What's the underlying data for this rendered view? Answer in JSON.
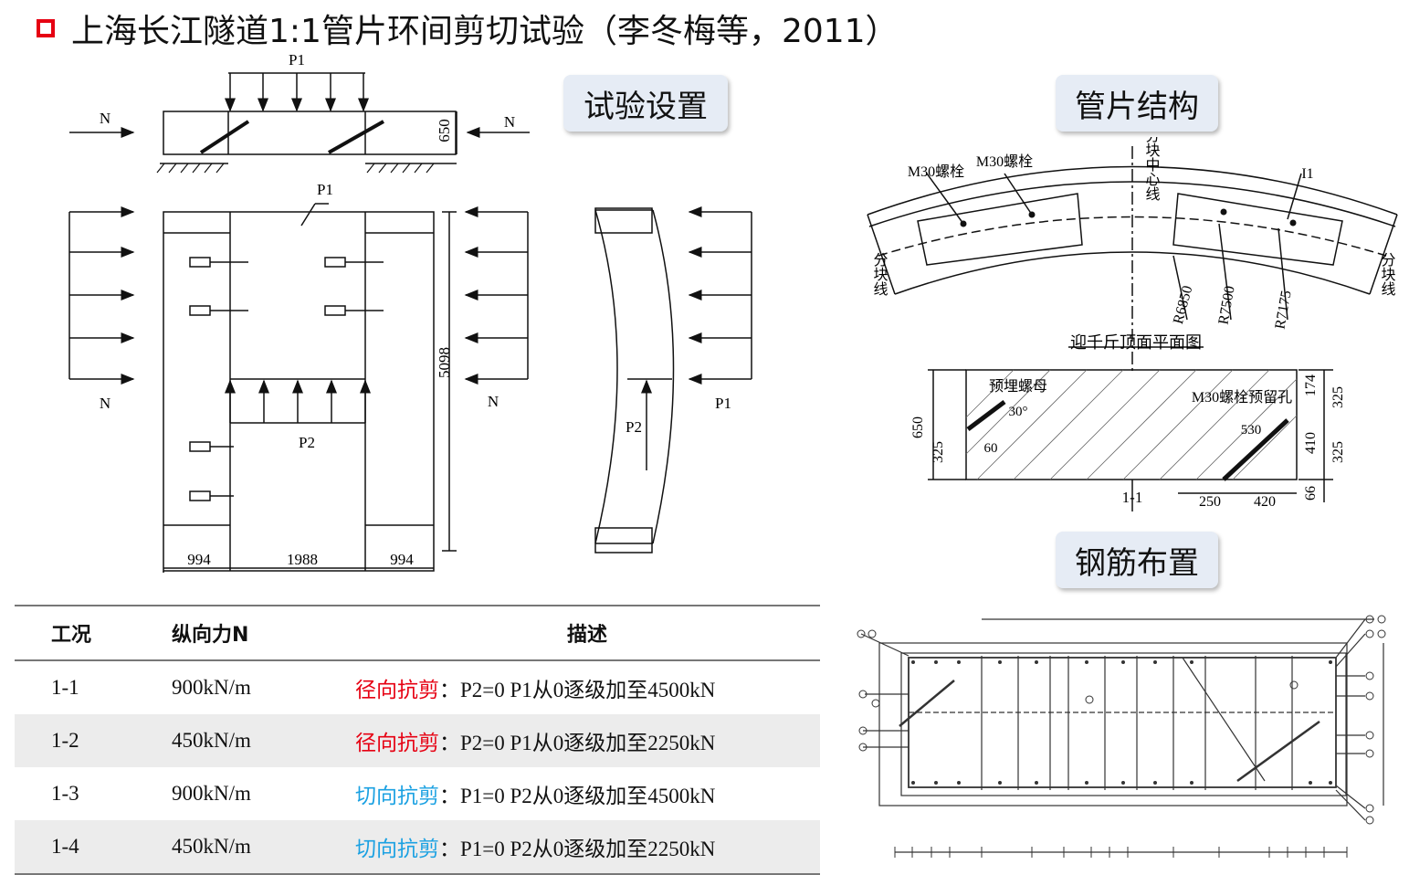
{
  "title": "上海长江隧道1:1管片环间剪切试验（李冬梅等，2011）",
  "labels": {
    "setup": "试验设置",
    "segment": "管片结构",
    "rebar": "钢筋布置"
  },
  "setup_diagram": {
    "P1": "P1",
    "P2": "P2",
    "N": "N",
    "h650": "650",
    "h5098": "5098",
    "w994": "994",
    "w1988": "1988"
  },
  "segment_diagram": {
    "bolt1": "M30螺栓",
    "bolt2": "M30螺栓",
    "center": "分块中心线",
    "split": "分块线",
    "R1": "R6850",
    "R2": "R7500",
    "R3": "R7175",
    "mark": "I1",
    "plan_title": "迎千斤顶面平面图",
    "nut": "预埋螺母",
    "hole": "M30螺栓预留孔",
    "d174": "174",
    "d325a": "325",
    "d410": "410",
    "d325b": "325",
    "d66": "66",
    "d650": "650",
    "d325c": "325",
    "d250": "250",
    "d420": "420",
    "d60": "60",
    "d30": "30°",
    "d530": "530",
    "section": "1-1"
  },
  "table": {
    "headers": [
      "工况",
      "纵向力N",
      "描述"
    ],
    "rows": [
      {
        "case": "1-1",
        "force": "900kN/m",
        "type": "径向抗剪",
        "desc": "：P2=0  P1从0逐级加至4500kN",
        "color": "#e60012"
      },
      {
        "case": "1-2",
        "force": "450kN/m",
        "type": "径向抗剪",
        "desc": "：P2=0  P1从0逐级加至2250kN",
        "color": "#e60012"
      },
      {
        "case": "1-3",
        "force": "900kN/m",
        "type": "切向抗剪",
        "desc": "：P1=0  P2从0逐级加至4500kN",
        "color": "#1ba1e2"
      },
      {
        "case": "1-4",
        "force": "450kN/m",
        "type": "切向抗剪",
        "desc": "：P1=0  P2从0逐级加至2250kN",
        "color": "#1ba1e2"
      }
    ]
  }
}
